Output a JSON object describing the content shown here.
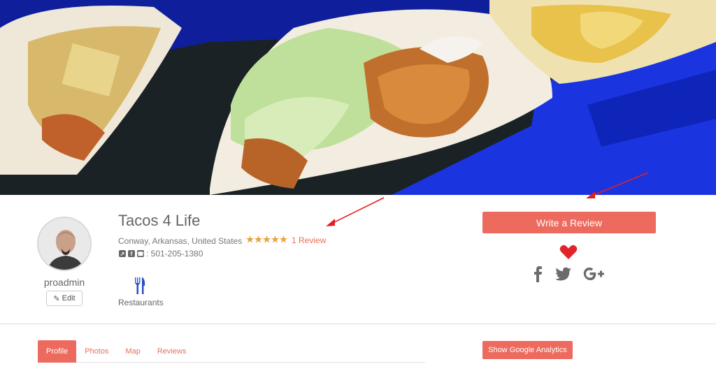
{
  "hero": {
    "image_description": "tacos-hero-photo"
  },
  "profile": {
    "username": "proadmin",
    "edit_label": "Edit"
  },
  "business": {
    "name": "Tacos 4 Life",
    "location": "Conway, Arkansas, United States",
    "rating": 5,
    "review_count_label": "1 Review",
    "phone": ": 501-205-1380",
    "category": "Restaurants"
  },
  "actions": {
    "write_review_label": "Write a Review",
    "analytics_label": "Show Google Analytics"
  },
  "tabs": [
    {
      "label": "Profile",
      "active": true
    },
    {
      "label": "Photos",
      "active": false
    },
    {
      "label": "Map",
      "active": false
    },
    {
      "label": "Reviews",
      "active": false
    }
  ],
  "colors": {
    "accent": "#ec6b5e",
    "link": "#e8705f",
    "heart": "#e0242a",
    "arrow": "#e02020",
    "star": "#e8a23a"
  },
  "icons": [
    "edit-icon",
    "phone-icon",
    "facebook-icon",
    "twitter-icon",
    "google-plus-icon",
    "heart-icon",
    "fork-knife-icon"
  ]
}
